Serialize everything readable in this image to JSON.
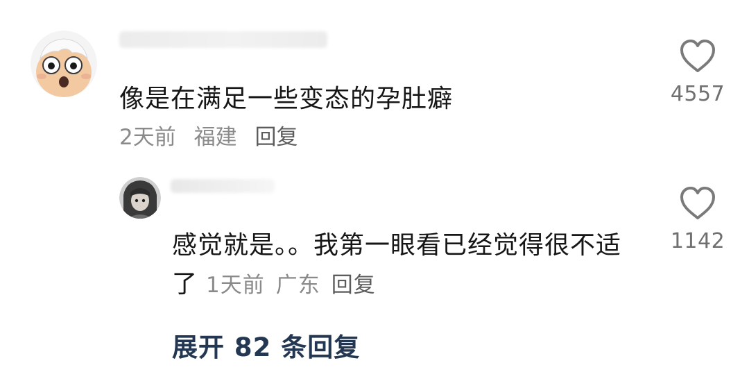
{
  "comment": {
    "avatar_icon": "cartoon-face-avatar",
    "text": "像是在满足一些变态的孕肚癖",
    "time": "2天前",
    "location": "福建",
    "reply_label": "回复",
    "like_icon": "heart-outline-icon",
    "like_count": "4557"
  },
  "reply": {
    "avatar_icon": "dark-hair-avatar",
    "text": "感觉就是。。我第一眼看已经觉得很不适了",
    "time": "1天前",
    "location": "广东",
    "reply_label": "回复",
    "like_icon": "heart-outline-icon",
    "like_count": "1142"
  },
  "expand": {
    "label": "展开 82 条回复"
  },
  "colors": {
    "text_primary": "#161616",
    "text_meta": "#8a8a8a",
    "expand_link": "#243752",
    "heart_stroke": "#7a7a7a"
  }
}
